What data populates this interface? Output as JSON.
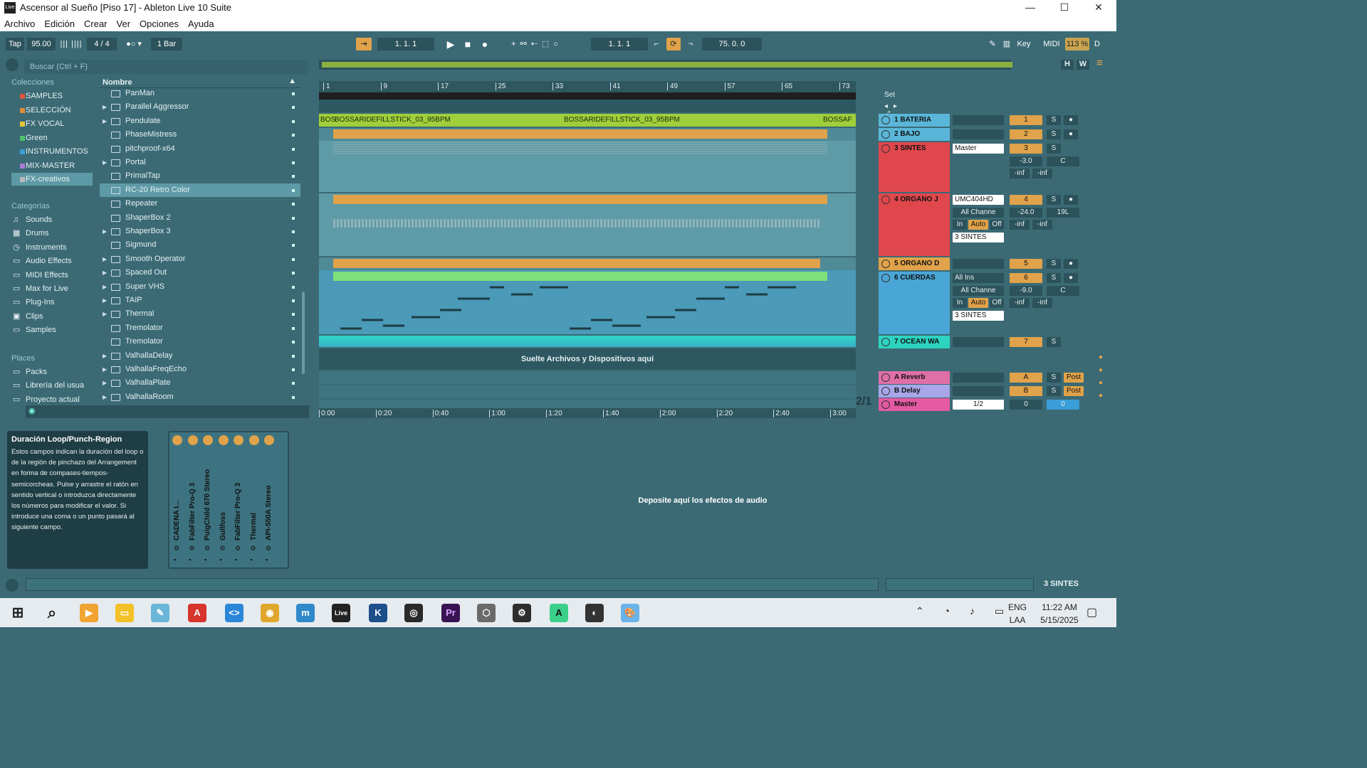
{
  "window": {
    "title": "Ascensor al Sueño  [Piso 17] - Ableton Live 10 Suite",
    "app_icon": "Live"
  },
  "menu": [
    "Archivo",
    "Edición",
    "Crear",
    "Ver",
    "Opciones",
    "Ayuda"
  ],
  "transport": {
    "tap": "Tap",
    "tempo": "95.00",
    "sig": "4 / 4",
    "quant": "1 Bar",
    "position": "1.   1.   1",
    "loop_start": "1.   1.   1",
    "loop_length": "75.   0.   0",
    "key": "Key",
    "midi": "MIDI",
    "cpu": "113 %",
    "d": "D"
  },
  "browser": {
    "search_placeholder": "Buscar (Ctrl + F)",
    "collections_header": "Colecciones",
    "collections": [
      {
        "label": "SAMPLES",
        "color": "#e0543d"
      },
      {
        "label": "SELECCIÓN",
        "color": "#e08c3a"
      },
      {
        "label": "FX VOCAL",
        "color": "#e8c53a"
      },
      {
        "label": "Green",
        "color": "#4fc06a"
      },
      {
        "label": "INSTRUMENTOS",
        "color": "#3a9ed8"
      },
      {
        "label": "MIX-MASTER",
        "color": "#a97ad6"
      },
      {
        "label": "FX-creativos",
        "color": "#bbbbbb"
      }
    ],
    "categories_header": "Categorías",
    "categories": [
      "Sounds",
      "Drums",
      "Instruments",
      "Audio Effects",
      "MIDI Effects",
      "Max for Live",
      "Plug-Ins",
      "Clips",
      "Samples"
    ],
    "places_header": "Places",
    "places": [
      "Packs",
      "Librería del usua",
      "Proyecto actual"
    ],
    "column_header": "Nombre",
    "items": [
      {
        "name": "PanMan",
        "arrow": false
      },
      {
        "name": "Parallel Aggressor",
        "arrow": true
      },
      {
        "name": "Pendulate",
        "arrow": true
      },
      {
        "name": "PhaseMistress",
        "arrow": false
      },
      {
        "name": "pitchproof-x64",
        "arrow": false
      },
      {
        "name": "Portal",
        "arrow": true
      },
      {
        "name": "PrimalTap",
        "arrow": false
      },
      {
        "name": "RC-20 Retro Color",
        "arrow": false
      },
      {
        "name": "Repeater",
        "arrow": false
      },
      {
        "name": "ShaperBox 2",
        "arrow": false
      },
      {
        "name": "ShaperBox 3",
        "arrow": true
      },
      {
        "name": "Sigmund",
        "arrow": false
      },
      {
        "name": "Smooth Operator",
        "arrow": true
      },
      {
        "name": "Spaced Out",
        "arrow": true
      },
      {
        "name": "Super VHS",
        "arrow": true
      },
      {
        "name": "TAIP",
        "arrow": true
      },
      {
        "name": "Thermal",
        "arrow": true
      },
      {
        "name": "Tremolator",
        "arrow": false
      },
      {
        "name": "Tremolator",
        "arrow": false
      },
      {
        "name": "ValhallaDelay",
        "arrow": true
      },
      {
        "name": "ValhallaFreqEcho",
        "arrow": true
      },
      {
        "name": "ValhallaPlate",
        "arrow": true
      },
      {
        "name": "ValhallaRoom",
        "arrow": true
      }
    ]
  },
  "arrangement": {
    "bar_labels": [
      "1",
      "9",
      "17",
      "25",
      "33",
      "41",
      "49",
      "57",
      "65",
      "73"
    ],
    "time_labels": [
      "0:00",
      "0:20",
      "0:40",
      "1:00",
      "1:20",
      "1:40",
      "2:00",
      "2:20",
      "2:40",
      "3:00"
    ],
    "clip1": "BOSSARIDEFILLSTICK_03_95BPM",
    "clip1_start": "BOS",
    "clip1_end": "BOSSAF",
    "drop_text": "Suelte Archivos y Dispositivos aquí",
    "zoom_ratio": "2/1",
    "set_label": "Set"
  },
  "tracks": [
    {
      "name": "1 BATERIA",
      "num": "1",
      "color": "#5ab6d8"
    },
    {
      "name": "2 BAJO",
      "num": "2",
      "color": "#5ab6d8"
    },
    {
      "name": "3 SINTES",
      "num": "3",
      "color": "#e0474c"
    },
    {
      "name": "4 ORGANO J",
      "num": "4",
      "color": "#e0474c"
    },
    {
      "name": "5 ORGANO D",
      "num": "5",
      "color": "#e0a24a"
    },
    {
      "name": "6 CUERDAS",
      "num": "6",
      "color": "#4aa6d6"
    },
    {
      "name": "7 OCEAN WA",
      "num": "7",
      "color": "#2ed3c0"
    }
  ],
  "returns": [
    {
      "name": "A Reverb",
      "num": "A",
      "color": "#e06fa8"
    },
    {
      "name": "B Delay",
      "num": "B",
      "color": "#a7a6e8"
    },
    {
      "name": "Master",
      "num": "0",
      "color": "#e45aa3"
    }
  ],
  "mixer": {
    "s": "S",
    "master_out": "Master",
    "vol3": "-3.0",
    "pan_c": "C",
    "inf": "-inf",
    "umc": "UMC404HD",
    "all_chan": "All Channe",
    "vol4": "-24.0",
    "pan19": "19L",
    "in": "In",
    "auto": "Auto",
    "off": "Off",
    "sintes3": "3 SINTES",
    "all_ins": "All Ins",
    "vol6": "-9.0",
    "post": "Post",
    "half": "1/2",
    "zero": "0"
  },
  "info": {
    "title": "Duración Loop/Punch-Region",
    "body": "Estos campos indican la duración del loop o de la región de pinchazo del Arrangement en forma de compases-tiempos-semicorcheas. Pulse y arrastre el ratón en sentido vertical o introduzca directamente los números para modificar el valor. Si introduce una coma o un punto pasará al siguiente campo."
  },
  "rack": [
    "CADENA I...",
    "FabFilter Pro-Q 3",
    "PuigChild 670 Stereo",
    "Gullfoss",
    "FabFilter Pro-Q 3",
    "Thermal",
    "API-550A Stereo"
  ],
  "device_drop": "Deposite aquí los efectos de audio",
  "status_track": "3 SINTES",
  "taskbar": {
    "lang1": "ENG",
    "lang2": "LAA",
    "time": "11:22 AM",
    "date": "5/15/2025",
    "live": "Live"
  }
}
